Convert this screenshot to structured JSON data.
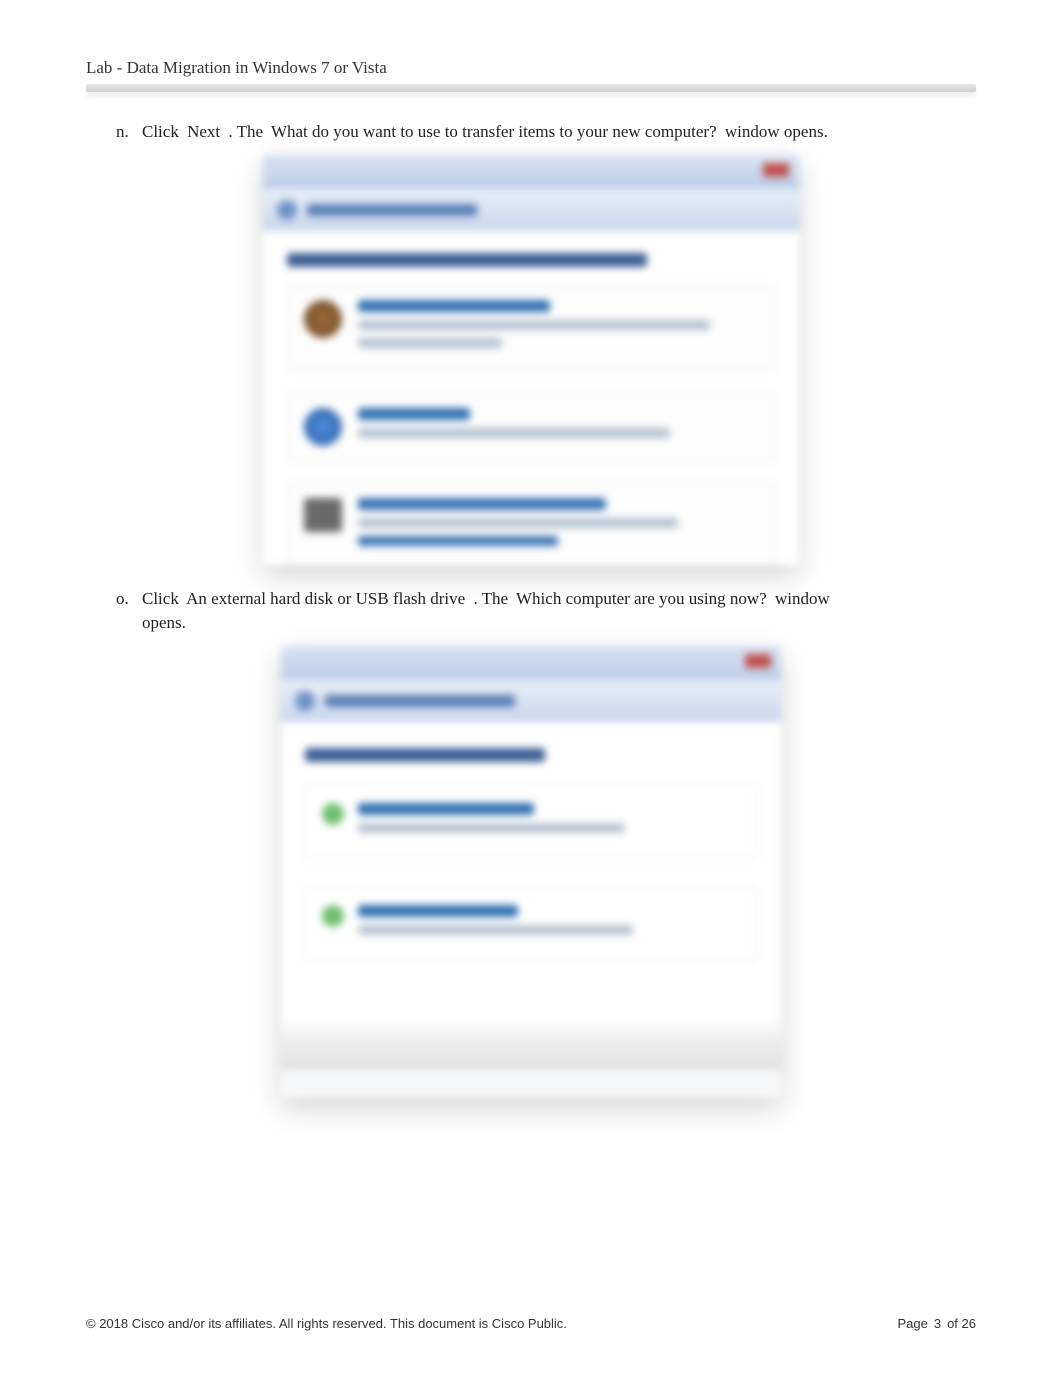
{
  "doc": {
    "title": "Lab - Data Migration in Windows 7 or Vista"
  },
  "steps": {
    "n": {
      "marker": "n.",
      "t1": "Click",
      "t2": "Next",
      "t3": ". The",
      "t4": "What do you want to use to transfer items to your new computer?",
      "t5": "window opens."
    },
    "o": {
      "marker": "o.",
      "t1": "Click",
      "t2": "An external hard disk or USB flash drive",
      "t3": ". The",
      "t4": "Which computer are you using now?",
      "t5": "window",
      "t6": "opens."
    }
  },
  "footer": {
    "copyright": "© 2018 Cisco and/or its affiliates. All rights reserved. This document is Cisco Public.",
    "page_label": "Page",
    "page_num": "3",
    "page_of": "of 26"
  }
}
